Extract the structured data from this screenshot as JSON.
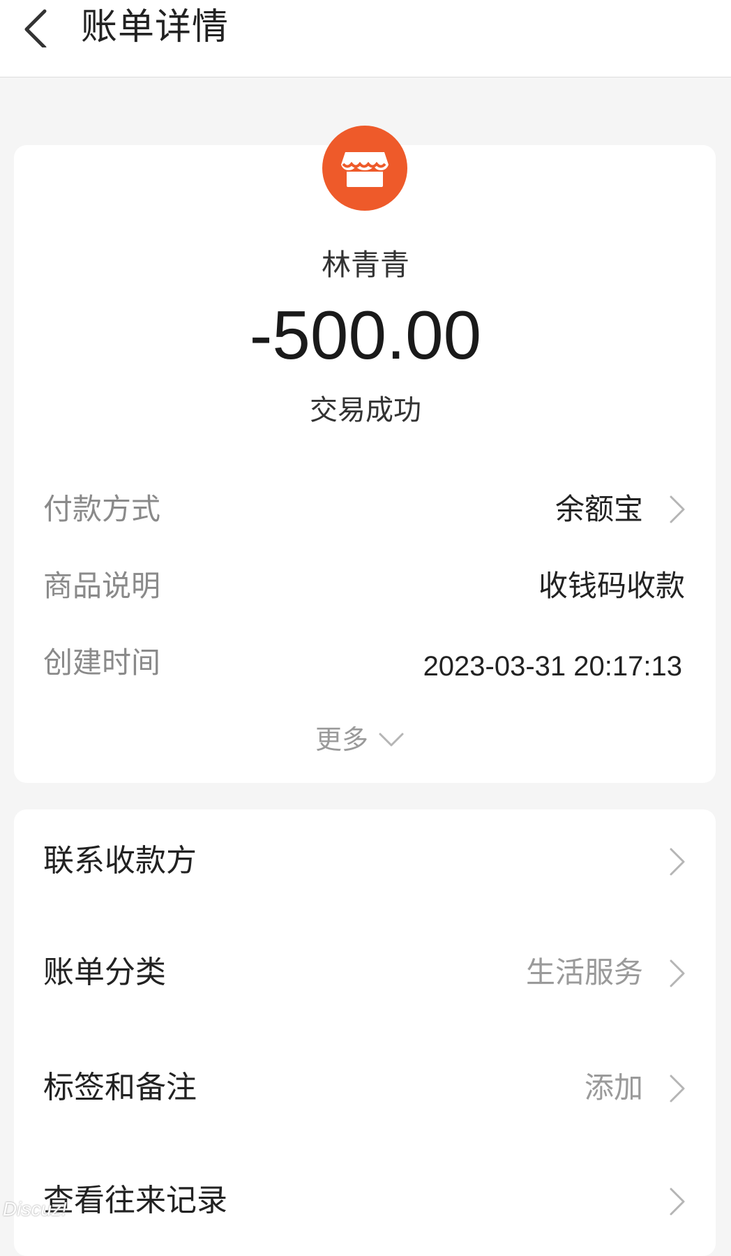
{
  "header": {
    "title": "账单详情"
  },
  "summary": {
    "icon": "store-icon",
    "icon_color": "#ee5a2a",
    "payee": "林青青",
    "amount": "-500.00",
    "status": "交易成功"
  },
  "details": [
    {
      "label": "付款方式",
      "value": "余额宝"
    },
    {
      "label": "商品说明",
      "value": "收钱码收款"
    },
    {
      "label": "创建时间",
      "value": "2023-03-31 20:17:13"
    }
  ],
  "more": {
    "label": "更多"
  },
  "actions": [
    {
      "label": "联系收款方",
      "value": ""
    },
    {
      "label": "账单分类",
      "value": "生活服务"
    },
    {
      "label": "标签和备注",
      "value": "添加"
    },
    {
      "label": "查看往来记录",
      "value": ""
    }
  ],
  "watermark": "Discuz!"
}
